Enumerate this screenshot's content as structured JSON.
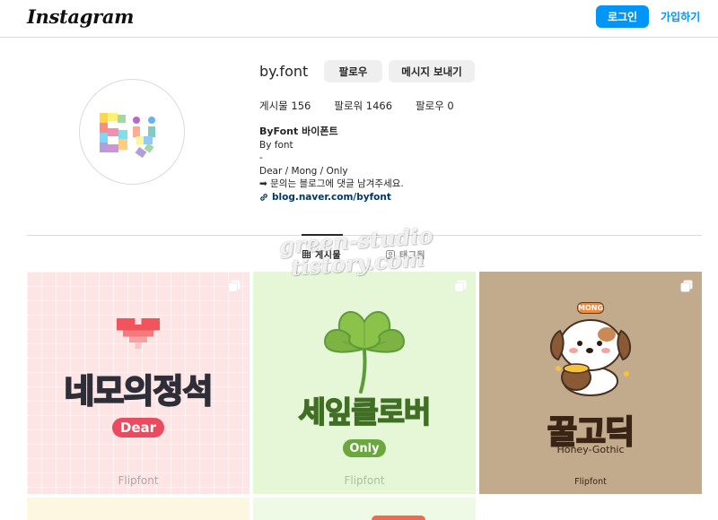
{
  "header": {
    "logo": "Instagram",
    "login_label": "로그인",
    "signup_label": "가입하기"
  },
  "profile": {
    "username": "by.font",
    "follow_label": "팔로우",
    "message_label": "메시지 보내기",
    "avatar_text": "By",
    "stats": {
      "posts": "게시물 156",
      "followers": "팔로워 1466",
      "following": "팔로우 0"
    },
    "bio": {
      "name": "ByFont 바이폰트",
      "line1": "By font",
      "line2": "-",
      "line3": "Dear / Mong / Only",
      "line4": "➡ 문의는 블로그에 댓글 남겨주세요.",
      "link": "blog.naver.com/byfont"
    }
  },
  "tabs": {
    "posts": "게시물",
    "tagged": "태그됨"
  },
  "watermark": {
    "line1": "green-studio",
    "line2": "tistory.com"
  },
  "posts": [
    {
      "title": "네모의정석",
      "badge": "Dear",
      "footer": "Flipfont"
    },
    {
      "title": "세잎클로버",
      "badge": "Only",
      "footer": "Flipfont"
    },
    {
      "title": "꿀고딕",
      "subtitle": "Honey-Gothic",
      "badge": "MONG",
      "footer": "Flipfont"
    }
  ],
  "colors": {
    "accent": "#0095f6",
    "link": "#00376b"
  }
}
